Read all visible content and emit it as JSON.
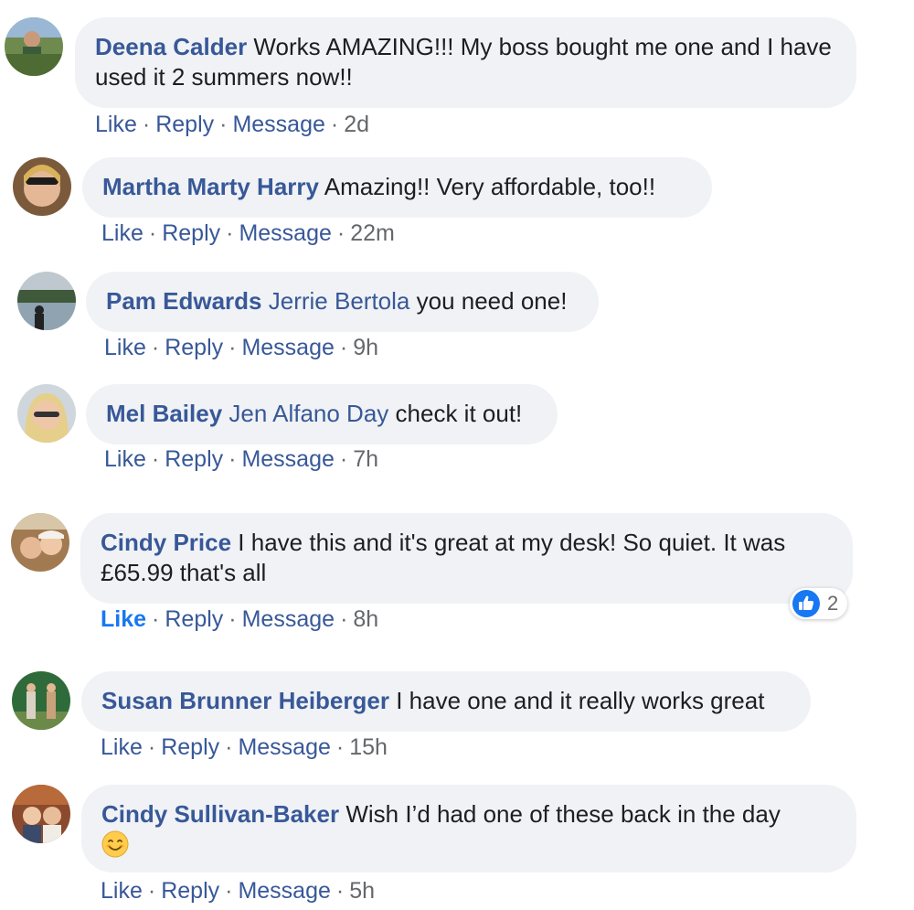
{
  "comments": [
    {
      "author": "Deena Calder",
      "mention": "",
      "text": "Works AMAZING!!! My boss bought me one and I have used it 2 summers now!!",
      "actions": {
        "like": "Like",
        "reply": "Reply",
        "message": "Message",
        "time": "2d"
      }
    },
    {
      "author": "Martha Marty Harry",
      "mention": "",
      "text": "Amazing!! Very affordable, too!!",
      "actions": {
        "like": "Like",
        "reply": "Reply",
        "message": "Message",
        "time": "22m"
      }
    },
    {
      "author": "Pam Edwards",
      "mention": "Jerrie Bertola",
      "text": "you need one!",
      "actions": {
        "like": "Like",
        "reply": "Reply",
        "message": "Message",
        "time": "9h"
      }
    },
    {
      "author": "Mel Bailey",
      "mention": "Jen Alfano Day",
      "text": "check it out!",
      "actions": {
        "like": "Like",
        "reply": "Reply",
        "message": "Message",
        "time": "7h"
      }
    },
    {
      "author": "Cindy Price",
      "mention": "",
      "text": "I have this and it's great at my desk! So quiet. It was £65.99 that's all",
      "actions": {
        "like": "Like",
        "reply": "Reply",
        "message": "Message",
        "time": "8h"
      },
      "reaction_count": "2"
    },
    {
      "author": "Susan Brunner Heiberger",
      "mention": "",
      "text": "I have one and it really works great",
      "actions": {
        "like": "Like",
        "reply": "Reply",
        "message": "Message",
        "time": "15h"
      }
    },
    {
      "author": "Cindy Sullivan-Baker",
      "mention": "",
      "text": "Wish I’d had one of these back in the day",
      "actions": {
        "like": "Like",
        "reply": "Reply",
        "message": "Message",
        "time": "5h"
      },
      "emoji": "smiling-face-emoji"
    }
  ],
  "colors": {
    "name_link": "#385898",
    "bubble_bg": "#f0f2f5",
    "liked": "#1877f2",
    "meta": "#65676b"
  }
}
